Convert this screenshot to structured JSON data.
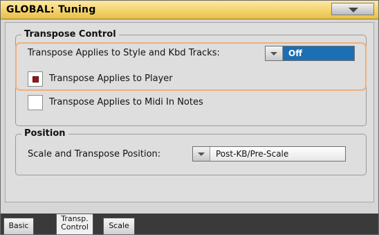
{
  "window": {
    "title": "GLOBAL: Tuning"
  },
  "transpose_group": {
    "title": "Transpose Control",
    "style_kbd_label": "Transpose Applies to Style and Kbd Tracks:",
    "style_kbd_value": "Off",
    "player_label": "Transpose Applies to Player",
    "player_checked": true,
    "midi_in_label": "Transpose Applies to Midi In Notes",
    "midi_in_checked": false
  },
  "position_group": {
    "title": "Position",
    "scale_transpose_label": "Scale and Transpose Position:",
    "scale_transpose_value": "Post-KB/Pre-Scale"
  },
  "tabs": [
    {
      "label": "Basic",
      "active": false
    },
    {
      "label_line1": "Transp.",
      "label_line2": "Control",
      "active": true
    },
    {
      "label": "Scale",
      "active": false
    }
  ],
  "colors": {
    "title_bar": "#f4d36c",
    "selected_value": "#1d6fb3",
    "highlight_outline": "#efb07a",
    "checkbox_mark": "#9e1515"
  }
}
